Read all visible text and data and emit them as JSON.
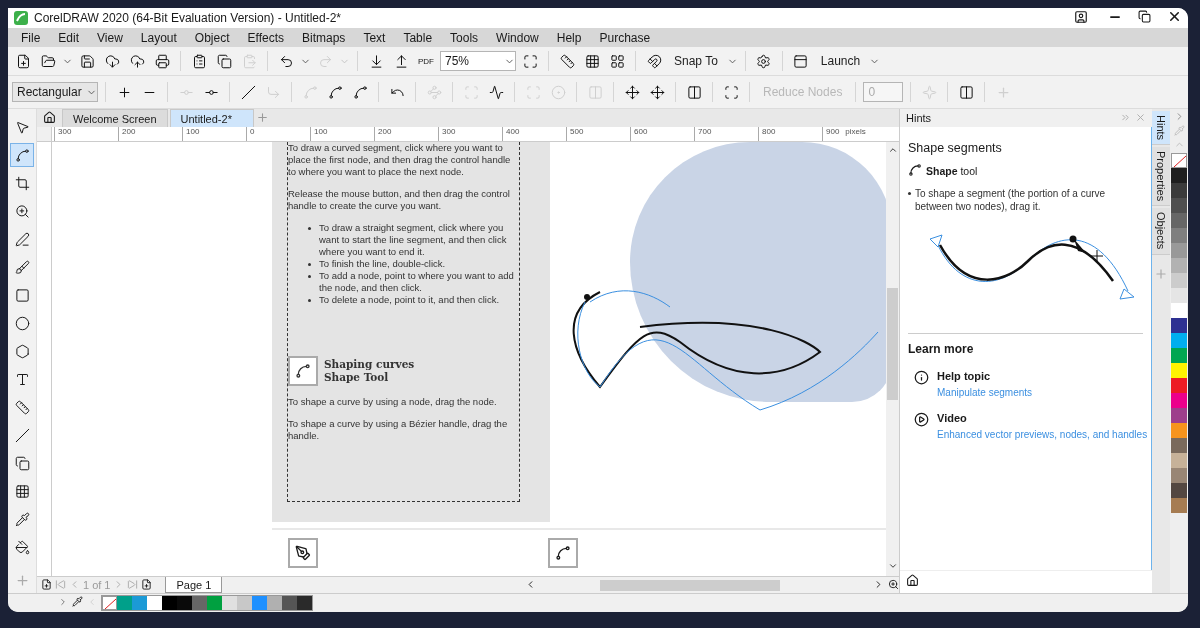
{
  "window": {
    "title": "CorelDRAW 2020 (64-Bit Evaluation Version) - Untitled-2*"
  },
  "menu": [
    "File",
    "Edit",
    "View",
    "Layout",
    "Object",
    "Effects",
    "Bitmaps",
    "Text",
    "Table",
    "Tools",
    "Window",
    "Help",
    "Purchase"
  ],
  "toolbar_1": [
    {
      "kind": "icon",
      "disabled": false
    },
    {
      "kind": "icon",
      "disabled": false
    },
    {
      "kind": "caret",
      "disabled": false
    },
    {
      "kind": "icon",
      "disabled": false
    },
    {
      "kind": "icon",
      "disabled": false
    },
    {
      "kind": "icon",
      "disabled": false
    },
    {
      "kind": "icon",
      "disabled": false
    },
    {
      "kind": "sep"
    },
    {
      "kind": "icon",
      "disabled": false
    },
    {
      "kind": "icon",
      "disabled": false
    },
    {
      "kind": "icon",
      "disabled": true
    },
    {
      "kind": "sep"
    },
    {
      "kind": "icon",
      "disabled": false
    },
    {
      "kind": "caret",
      "disabled": false
    },
    {
      "kind": "icon",
      "disabled": true
    },
    {
      "kind": "caret",
      "disabled": true
    },
    {
      "kind": "sep"
    },
    {
      "kind": "icon",
      "disabled": false
    },
    {
      "kind": "icon",
      "disabled": false
    },
    {
      "kind": "pdf",
      "label": "PDF"
    },
    {
      "kind": "zoom",
      "value": "75%"
    },
    {
      "kind": "icon",
      "disabled": false
    },
    {
      "kind": "sep"
    },
    {
      "kind": "icon",
      "disabled": false
    },
    {
      "kind": "icon",
      "disabled": false
    },
    {
      "kind": "icon",
      "disabled": false
    },
    {
      "kind": "sep"
    },
    {
      "kind": "icon",
      "disabled": false
    },
    {
      "kind": "dropdown",
      "label": "Snap To"
    },
    {
      "kind": "sep"
    },
    {
      "kind": "icon",
      "disabled": false
    },
    {
      "kind": "sep"
    },
    {
      "kind": "icon",
      "disabled": false
    },
    {
      "kind": "dropdown",
      "label": "Launch"
    }
  ],
  "toolbar_2": [
    {
      "kind": "select",
      "value": "Rectangular"
    },
    {
      "kind": "sep"
    },
    {
      "kind": "icon",
      "disabled": false
    },
    {
      "kind": "icon",
      "disabled": false
    },
    {
      "kind": "sep"
    },
    {
      "kind": "icon",
      "disabled": true
    },
    {
      "kind": "icon",
      "disabled": false
    },
    {
      "kind": "sep"
    },
    {
      "kind": "icon",
      "disabled": false
    },
    {
      "kind": "icon",
      "disabled": true
    },
    {
      "kind": "sep"
    },
    {
      "kind": "icon",
      "disabled": true
    },
    {
      "kind": "icon",
      "disabled": false
    },
    {
      "kind": "icon",
      "disabled": false
    },
    {
      "kind": "sep"
    },
    {
      "kind": "icon",
      "disabled": false
    },
    {
      "kind": "sep"
    },
    {
      "kind": "icon",
      "disabled": true
    },
    {
      "kind": "sep"
    },
    {
      "kind": "icon",
      "disabled": true
    },
    {
      "kind": "icon",
      "disabled": false
    },
    {
      "kind": "sep"
    },
    {
      "kind": "icon",
      "disabled": true
    },
    {
      "kind": "icon",
      "disabled": true
    },
    {
      "kind": "sep"
    },
    {
      "kind": "icon",
      "disabled": true
    },
    {
      "kind": "sep"
    },
    {
      "kind": "icon",
      "disabled": false
    },
    {
      "kind": "icon",
      "disabled": false
    },
    {
      "kind": "sep"
    },
    {
      "kind": "icon",
      "disabled": false
    },
    {
      "kind": "sep"
    },
    {
      "kind": "icon",
      "disabled": false
    },
    {
      "kind": "sep"
    },
    {
      "kind": "text_button",
      "label": "Reduce Nodes",
      "disabled": true
    },
    {
      "kind": "sep"
    },
    {
      "kind": "spin",
      "value": "0",
      "disabled": true
    },
    {
      "kind": "sep"
    },
    {
      "kind": "icon",
      "disabled": true
    },
    {
      "kind": "sep"
    },
    {
      "kind": "icon",
      "disabled": false
    },
    {
      "kind": "sep"
    },
    {
      "kind": "add"
    }
  ],
  "toolbox": [
    {
      "selected": false
    },
    {
      "selected": true
    },
    {
      "selected": false
    },
    {
      "selected": false
    },
    {
      "selected": false
    },
    {
      "selected": false
    },
    {
      "selected": false
    },
    {
      "selected": false
    },
    {
      "selected": false
    },
    {
      "selected": false
    },
    {
      "selected": false
    },
    {
      "selected": false
    },
    {
      "selected": false
    },
    {
      "selected": false
    },
    {
      "selected": false
    },
    {
      "selected": false
    }
  ],
  "doc_tabs": [
    {
      "label": "Welcome Screen",
      "selected": false
    },
    {
      "label": "Untitled-2*",
      "selected": true
    }
  ],
  "ruler": {
    "labels": [
      "300",
      "200",
      "100",
      "0",
      "100",
      "200",
      "300",
      "400",
      "500",
      "600",
      "700",
      "800",
      "900"
    ],
    "unit": "pixels"
  },
  "document": {
    "paragraphs": [
      "To draw a curved segment, click where you want to place the first node, and then drag the control handle to where you want to place the next node.",
      "Release the mouse button, and then drag the control handle to create the curve you want."
    ],
    "bullets": [
      "To draw a straight segment, click where you want to start the line segment, and then click where you want to end it.",
      "To finish the line, double-click.",
      "To add a node, point to where you want to add the node, and then click.",
      "To delete a node, point to it, and then click."
    ],
    "heading": [
      "Shaping curves",
      "Shape Tool"
    ],
    "paragraphs_2": [
      "To shape a curve by using a node, drag the node.",
      "To shape a curve by using a Bézier handle, drag the handle."
    ]
  },
  "page_nav": {
    "current": "1",
    "of": "of",
    "total": "1",
    "page_tab": "Page 1"
  },
  "hints": {
    "title": "Hints",
    "heading": "Shape segments",
    "tool_bold": "Shape",
    "tool_rest": "tool",
    "bullet": "To shape a segment (the portion of a curve between two nodes), drag it.",
    "learn_more": "Learn more",
    "links": [
      {
        "kind": "info",
        "title": "Help topic",
        "link": "Manipulate segments"
      },
      {
        "kind": "video",
        "title": "Video",
        "link": "Enhanced vector previews, nodes, and handles"
      }
    ]
  },
  "side_tabs": [
    {
      "label": "Hints",
      "selected": true
    },
    {
      "label": "Properties",
      "selected": false
    },
    {
      "label": "Objects",
      "selected": false
    }
  ],
  "palette": [
    {
      "kind": "none"
    },
    {
      "color": "#1f1f1f"
    },
    {
      "color": "#3b3b3b"
    },
    {
      "color": "#4f4f4f"
    },
    {
      "color": "#666666"
    },
    {
      "color": "#7f7f7f"
    },
    {
      "color": "#999999"
    },
    {
      "color": "#b2b2b2"
    },
    {
      "color": "#cccccc"
    },
    {
      "color": "#e5e5e5"
    },
    {
      "color": "#ffffff"
    },
    {
      "color": "#2e3192"
    },
    {
      "color": "#00aeef"
    },
    {
      "color": "#00a651"
    },
    {
      "color": "#fff200"
    },
    {
      "color": "#ed1c24"
    },
    {
      "color": "#ec008c"
    },
    {
      "color": "#9e3f8c"
    },
    {
      "color": "#f7941d"
    },
    {
      "color": "#7a6a5c"
    },
    {
      "color": "#c7b299"
    },
    {
      "color": "#998675"
    },
    {
      "color": "#534741"
    },
    {
      "color": "#a67c52"
    }
  ],
  "doc_palette": [
    {
      "kind": "none"
    },
    {
      "color": "#00a08a"
    },
    {
      "color": "#1b9ad6"
    },
    {
      "color": "#ffffff"
    },
    {
      "color": "#000000"
    },
    {
      "color": "#0a0a0a"
    },
    {
      "color": "#666666"
    },
    {
      "color": "#00a040"
    },
    {
      "color": "#e0e0e0"
    },
    {
      "color": "#c8c8c8"
    },
    {
      "color": "#1e90ff"
    },
    {
      "color": "#b0b0b0"
    },
    {
      "color": "#555555"
    },
    {
      "color": "#2a2a2a"
    }
  ]
}
